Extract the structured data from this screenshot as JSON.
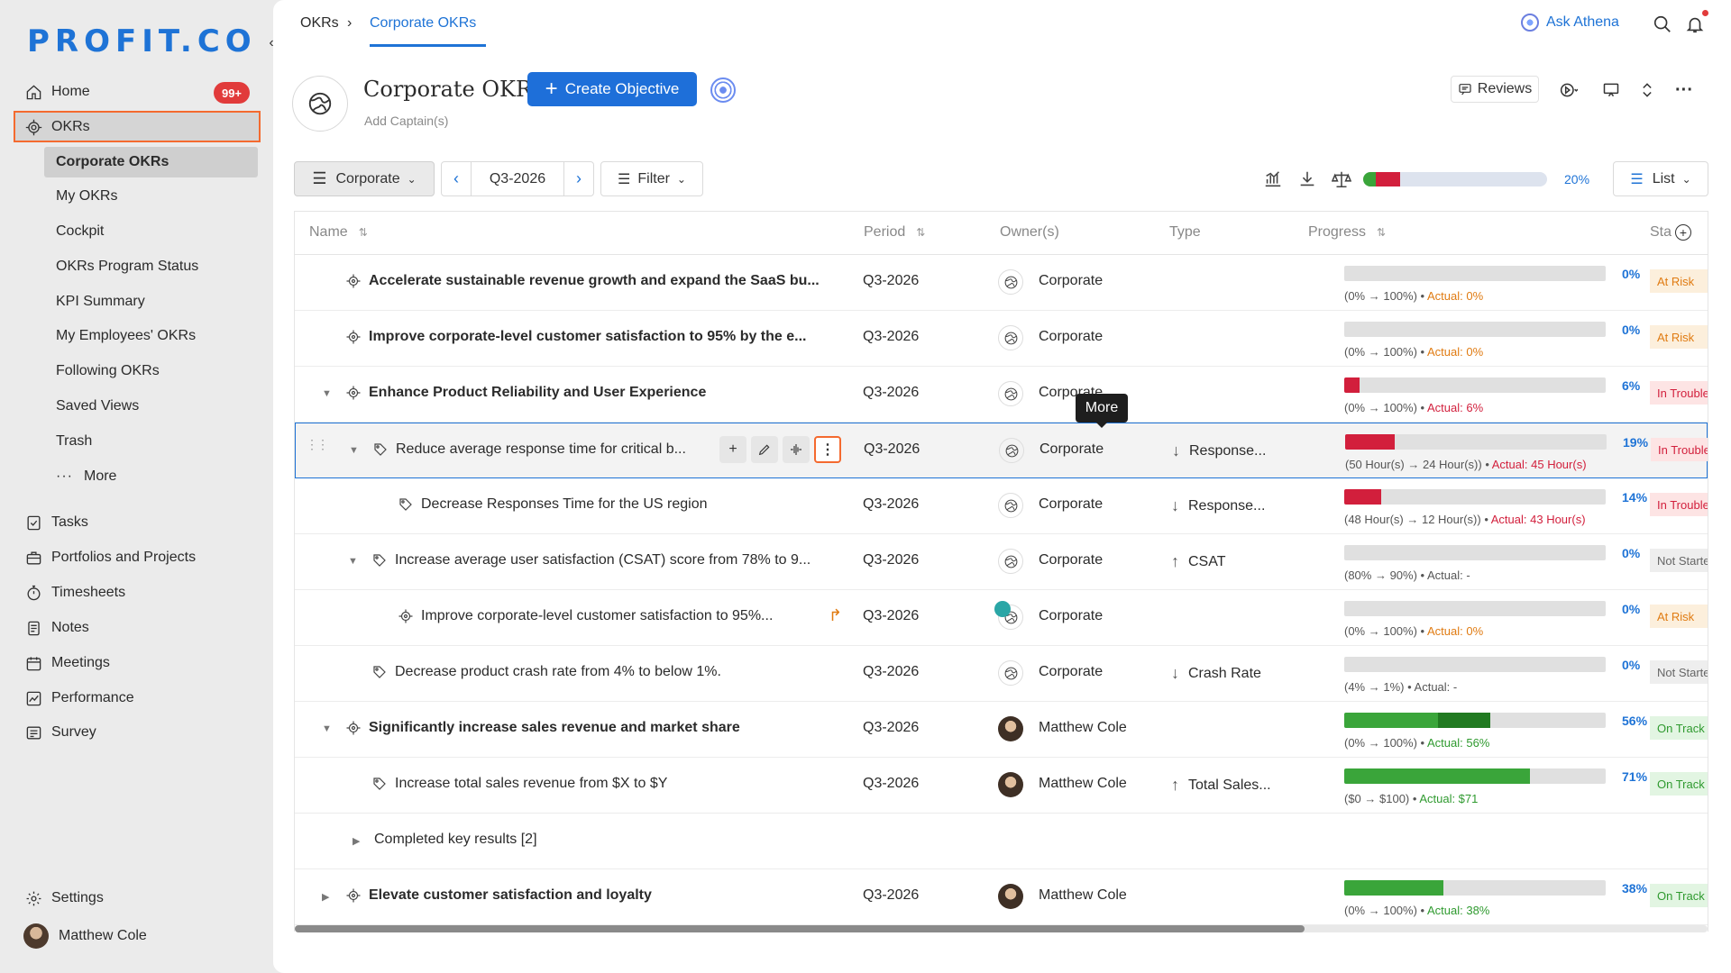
{
  "sidebar": {
    "logo": "PROFIT.CO",
    "collapse_icon": "chevron-left-icon",
    "home_label": "Home",
    "home_badge": "99+",
    "okrs_label": "OKRs",
    "okr_subitems": [
      "Corporate OKRs",
      "My OKRs",
      "Cockpit",
      "OKRs Program Status",
      "KPI Summary",
      "My Employees' OKRs",
      "Following OKRs",
      "Saved Views",
      "Trash",
      "More"
    ],
    "more_icon": "ellipsis-icon",
    "items": [
      "Tasks",
      "Portfolios and Projects",
      "Timesheets",
      "Notes",
      "Meetings",
      "Performance",
      "Survey"
    ],
    "settings_label": "Settings",
    "user_name": "Matthew Cole"
  },
  "topbar": {
    "breadcrumb_root": "OKRs",
    "breadcrumb_sep": "›",
    "breadcrumb_current": "Corporate OKRs",
    "ask_athena": "Ask Athena"
  },
  "header": {
    "title": "Corporate OKRs",
    "add_captain": "Add Captain(s)",
    "create_button": "Create Objective",
    "reviews_button": "Reviews"
  },
  "toolbar": {
    "scope": "Corporate",
    "period": "Q3-2026",
    "filter": "Filter",
    "overall_progress_pct": "20%",
    "overall_progress": 0.2,
    "view": "List"
  },
  "columns": {
    "name": "Name",
    "period": "Period",
    "owners": "Owner(s)",
    "type": "Type",
    "progress": "Progress",
    "status": "Sta"
  },
  "tooltip": "More",
  "rows": [
    {
      "name": "Accelerate sustainable revenue growth and expand the SaaS bu...",
      "period": "Q3-2026",
      "owner": "Corporate",
      "type": "",
      "pct": "0%",
      "detail_range": "(0% → 100%)",
      "detail_actual": "Actual: 0%",
      "status": "At Risk"
    },
    {
      "name": "Improve corporate-level customer satisfaction to 95% by the e...",
      "period": "Q3-2026",
      "owner": "Corporate",
      "type": "",
      "pct": "0%",
      "detail_range": "(0% → 100%)",
      "detail_actual": "Actual: 0%",
      "status": "At Risk"
    },
    {
      "name": "Enhance Product Reliability and User Experience",
      "period": "Q3-2026",
      "owner": "Corporate",
      "type": "",
      "pct": "6%",
      "detail_range": "(0% → 100%)",
      "detail_actual": "Actual: 6%",
      "status": "In Trouble"
    },
    {
      "name": "Reduce average response time for critical b...",
      "period": "Q3-2026",
      "owner": "Corporate",
      "type": "Response...",
      "pct": "19%",
      "detail_range": "(50 Hour(s) → 24 Hour(s))",
      "detail_actual": "Actual: 45 Hour(s)",
      "status": "In Trouble"
    },
    {
      "name": "Decrease Responses Time for the US region",
      "period": "Q3-2026",
      "owner": "Corporate",
      "type": "Response...",
      "pct": "14%",
      "detail_range": "(48 Hour(s) → 12 Hour(s))",
      "detail_actual": "Actual: 43 Hour(s)",
      "status": "In Trouble"
    },
    {
      "name": "Increase average user satisfaction (CSAT) score from 78% to 9...",
      "period": "Q3-2026",
      "owner": "Corporate",
      "type": "CSAT",
      "pct": "0%",
      "detail_range": "(80% → 90%)",
      "detail_actual": "Actual: -",
      "status": "Not Started"
    },
    {
      "name": "Improve corporate-level customer satisfaction to 95%...",
      "period": "Q3-2026",
      "owner": "Corporate",
      "type": "",
      "pct": "0%",
      "detail_range": "(0% → 100%)",
      "detail_actual": "Actual: 0%",
      "status": "At Risk"
    },
    {
      "name": "Decrease product crash rate from 4% to below 1%.",
      "period": "Q3-2026",
      "owner": "Corporate",
      "type": "Crash Rate",
      "pct": "0%",
      "detail_range": "(4% → 1%)",
      "detail_actual": "Actual: -",
      "status": "Not Started"
    },
    {
      "name": "Significantly increase sales revenue and market share",
      "period": "Q3-2026",
      "owner": "Matthew Cole",
      "type": "",
      "pct": "56%",
      "detail_range": "(0% → 100%)",
      "detail_actual": "Actual: 56%",
      "status": "On Track"
    },
    {
      "name": "Increase total sales revenue from $X to $Y",
      "period": "Q3-2026",
      "owner": "Matthew Cole",
      "type": "Total Sales...",
      "pct": "71%",
      "detail_range": "($0 → $100)",
      "detail_actual": "Actual: $71",
      "status": "On Track"
    },
    {
      "name": "Completed key results [2]"
    },
    {
      "name": "Elevate customer satisfaction and loyalty",
      "period": "Q3-2026",
      "owner": "Matthew Cole",
      "type": "",
      "pct": "38%",
      "detail_range": "(0% → 100%)",
      "detail_actual": "Actual: 38%",
      "status": "On Track"
    }
  ],
  "colors": {
    "accent": "#1e73d6",
    "at_risk_bg": "#fcefdc",
    "at_risk_text": "#e07b12",
    "in_trouble_bg": "#fde4e4",
    "in_trouble_text": "#d21f3c",
    "on_track_bg": "#e2f5e2",
    "on_track_text": "#2f9a2f",
    "not_started_bg": "#eeeeee",
    "not_started_text": "#666666",
    "bar_red": "#d21f3c",
    "bar_green": "#3aa53a",
    "bar_dark_green": "#217a21"
  }
}
